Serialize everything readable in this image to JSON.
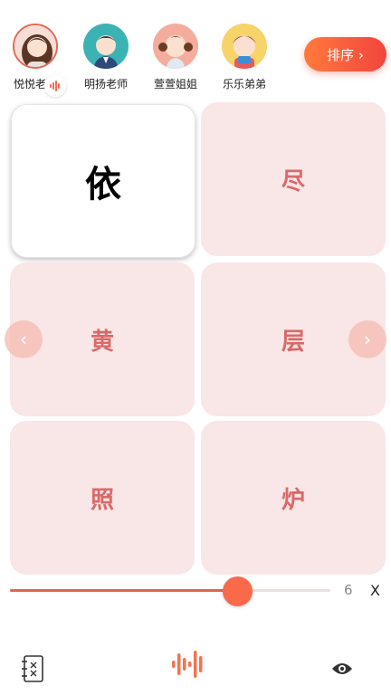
{
  "teachers": [
    {
      "name": "悦悦老师",
      "selected": true
    },
    {
      "name": "明扬老师",
      "selected": false
    },
    {
      "name": "萱萱姐姐",
      "selected": false
    },
    {
      "name": "乐乐弟弟",
      "selected": false
    }
  ],
  "sort_button": {
    "label": "排序 ›"
  },
  "cards": [
    {
      "char": "依",
      "active": true
    },
    {
      "char": "尽",
      "active": false
    },
    {
      "char": "黄",
      "active": false
    },
    {
      "char": "层",
      "active": false
    },
    {
      "char": "照",
      "active": false
    },
    {
      "char": "炉",
      "active": false
    }
  ],
  "nav": {
    "left_label": "‹",
    "right_label": "›"
  },
  "slider": {
    "value_label": "6",
    "fraction": 0.71
  },
  "close_label": "X",
  "colors": {
    "accent": "#f2453d",
    "card_bg": "#f9e6e6",
    "card_text": "#d96a6a"
  },
  "bottom_bar": {
    "icons": [
      "notebook-icon",
      "audio-wave-icon",
      "eye-icon"
    ]
  }
}
